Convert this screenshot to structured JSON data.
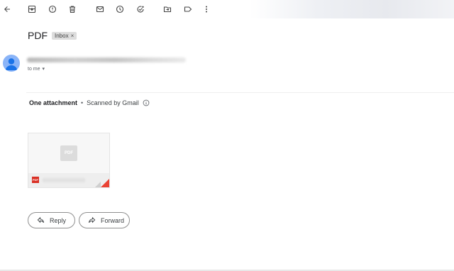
{
  "toolbar": {
    "icons": [
      "back-arrow-icon",
      "archive-icon",
      "report-spam-icon",
      "delete-icon",
      "mark-unread-icon",
      "snooze-icon",
      "add-task-icon",
      "move-to-icon",
      "label-icon",
      "more-vert-icon"
    ]
  },
  "email": {
    "subject": "PDF",
    "label": "Inbox",
    "label_close": "×",
    "to_line": "to me",
    "to_caret": "▾"
  },
  "attachments": {
    "count_text": "One attachment",
    "separator": "•",
    "scanned_text": "Scanned by Gmail",
    "thumbnail_badge": "PDF",
    "file_type_badge": "PDF"
  },
  "actions": {
    "reply_label": "Reply",
    "forward_label": "Forward"
  },
  "colors": {
    "avatar": "#8ab4f8",
    "pdf_red": "#d93025",
    "fold_red": "#ea4335"
  }
}
